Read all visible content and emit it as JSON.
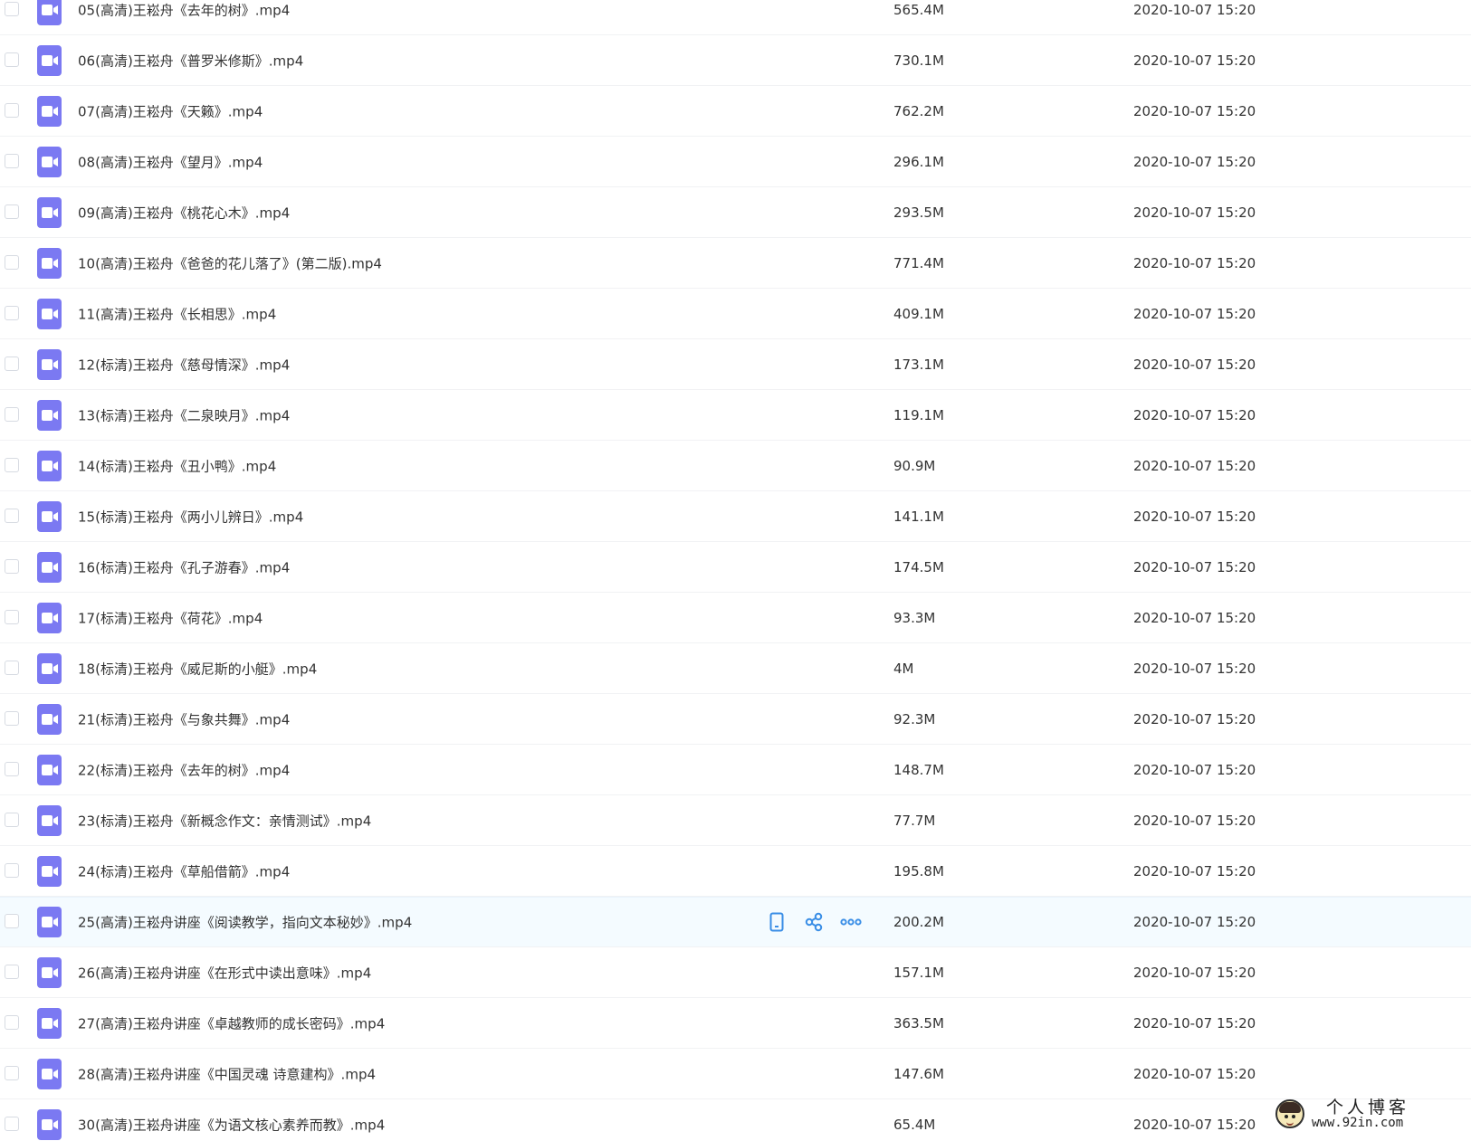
{
  "colors": {
    "video_icon": "#7B79F2",
    "text": "#333333",
    "hover_row_bg": "#f4fbff",
    "action_icon": "#3a8ee6",
    "row_border": "#f1f2f4"
  },
  "file_icon": "video-file-icon",
  "hover_actions": [
    "phone-icon",
    "share-icon",
    "more-icon"
  ],
  "files": [
    {
      "name": "05(高清)王崧舟《去年的树》.mp4",
      "size": "565.4M",
      "time": "2020-10-07 15:20"
    },
    {
      "name": "06(高清)王崧舟《普罗米修斯》.mp4",
      "size": "730.1M",
      "time": "2020-10-07 15:20"
    },
    {
      "name": "07(高清)王崧舟《天籁》.mp4",
      "size": "762.2M",
      "time": "2020-10-07 15:20"
    },
    {
      "name": "08(高清)王崧舟《望月》.mp4",
      "size": "296.1M",
      "time": "2020-10-07 15:20"
    },
    {
      "name": "09(高清)王崧舟《桃花心木》.mp4",
      "size": "293.5M",
      "time": "2020-10-07 15:20"
    },
    {
      "name": "10(高清)王崧舟《爸爸的花儿落了》(第二版).mp4",
      "size": "771.4M",
      "time": "2020-10-07 15:20"
    },
    {
      "name": "11(高清)王崧舟《长相思》.mp4",
      "size": "409.1M",
      "time": "2020-10-07 15:20"
    },
    {
      "name": "12(标清)王崧舟《慈母情深》.mp4",
      "size": "173.1M",
      "time": "2020-10-07 15:20"
    },
    {
      "name": "13(标清)王崧舟《二泉映月》.mp4",
      "size": "119.1M",
      "time": "2020-10-07 15:20"
    },
    {
      "name": "14(标清)王崧舟《丑小鸭》.mp4",
      "size": "90.9M",
      "time": "2020-10-07 15:20"
    },
    {
      "name": "15(标清)王崧舟《两小儿辨日》.mp4",
      "size": "141.1M",
      "time": "2020-10-07 15:20"
    },
    {
      "name": "16(标清)王崧舟《孔子游春》.mp4",
      "size": "174.5M",
      "time": "2020-10-07 15:20"
    },
    {
      "name": "17(标清)王崧舟《荷花》.mp4",
      "size": "93.3M",
      "time": "2020-10-07 15:20"
    },
    {
      "name": "18(标清)王崧舟《威尼斯的小艇》.mp4",
      "size": "4M",
      "time": "2020-10-07 15:20"
    },
    {
      "name": "21(标清)王崧舟《与象共舞》.mp4",
      "size": "92.3M",
      "time": "2020-10-07 15:20"
    },
    {
      "name": "22(标清)王崧舟《去年的树》.mp4",
      "size": "148.7M",
      "time": "2020-10-07 15:20"
    },
    {
      "name": "23(标清)王崧舟《新概念作文：亲情测试》.mp4",
      "size": "77.7M",
      "time": "2020-10-07 15:20"
    },
    {
      "name": "24(标清)王崧舟《草船借箭》.mp4",
      "size": "195.8M",
      "time": "2020-10-07 15:20"
    },
    {
      "name": "25(高清)王崧舟讲座《阅读教学，指向文本秘妙》.mp4",
      "size": "200.2M",
      "time": "2020-10-07 15:20",
      "hovered": true
    },
    {
      "name": "26(高清)王崧舟讲座《在形式中读出意味》.mp4",
      "size": "157.1M",
      "time": "2020-10-07 15:20"
    },
    {
      "name": "27(高清)王崧舟讲座《卓越教师的成长密码》.mp4",
      "size": "363.5M",
      "time": "2020-10-07 15:20"
    },
    {
      "name": "28(高清)王崧舟讲座《中国灵魂 诗意建构》.mp4",
      "size": "147.6M",
      "time": "2020-10-07 15:20"
    },
    {
      "name": "30(高清)王崧舟讲座《为语文核心素养而教》.mp4",
      "size": "65.4M",
      "time": "2020-10-07 15:20"
    }
  ],
  "watermark": {
    "title": "个人博客",
    "url": "www.92in.com"
  }
}
